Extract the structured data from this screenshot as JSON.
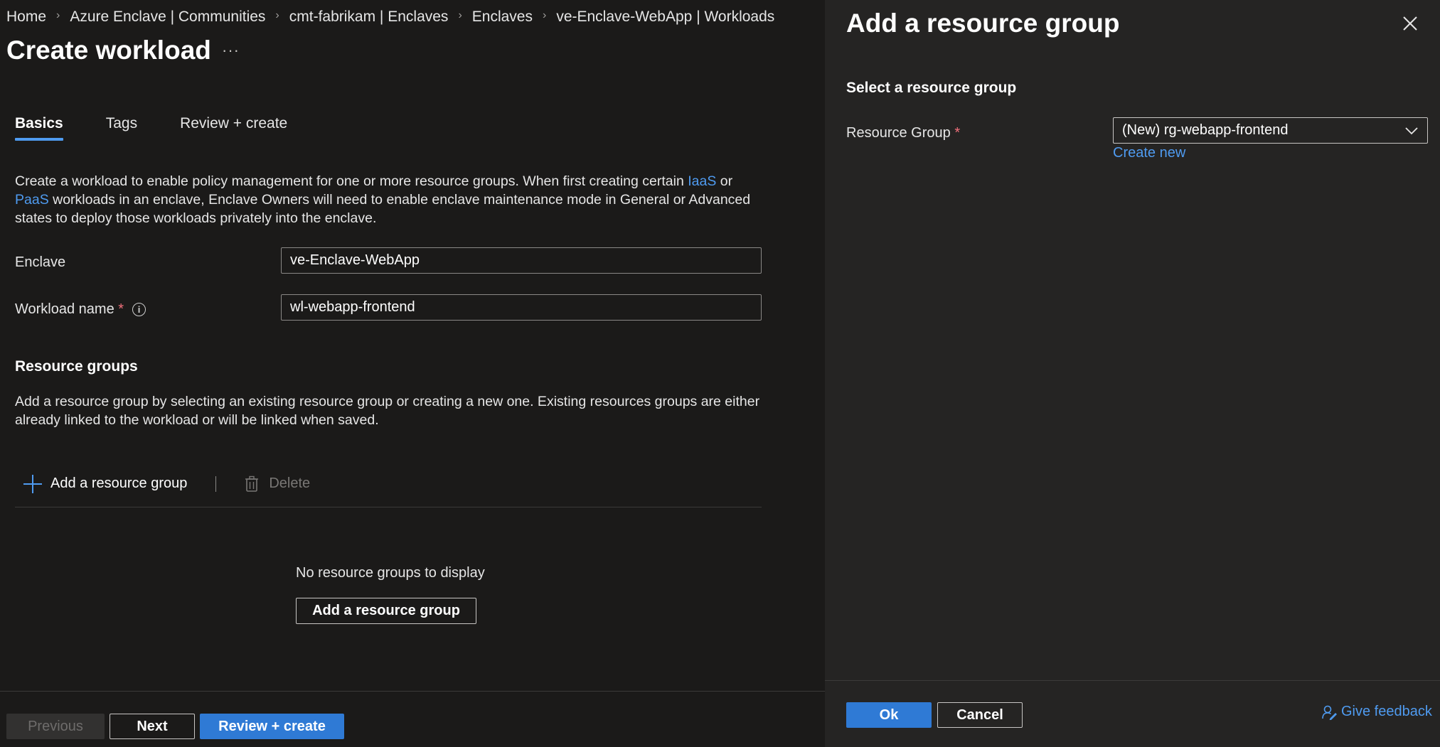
{
  "breadcrumb": [
    {
      "label": "Home"
    },
    {
      "label": "Azure Enclave | Communities"
    },
    {
      "label": "cmt-fabrikam | Enclaves"
    },
    {
      "label": "Enclaves"
    },
    {
      "label": "ve-Enclave-WebApp | Workloads"
    }
  ],
  "page": {
    "title": "Create workload",
    "more": "···"
  },
  "tabs": [
    {
      "label": "Basics",
      "active": true
    },
    {
      "label": "Tags",
      "active": false
    },
    {
      "label": "Review + create",
      "active": false
    }
  ],
  "description": {
    "part1": "Create a workload to enable policy management for one or more resource groups. When first creating certain ",
    "link1": "IaaS",
    "part2": " or ",
    "link2": "PaaS",
    "part3": " workloads in an enclave, Enclave Owners will need to enable enclave maintenance mode in General or Advanced states to deploy those workloads privately into the enclave."
  },
  "form": {
    "enclave_label": "Enclave",
    "enclave_value": "ve-Enclave-WebApp",
    "workload_label": "Workload name",
    "workload_value": "wl-webapp-frontend",
    "required_mark": "*",
    "info_glyph": "i"
  },
  "resource_groups": {
    "title": "Resource groups",
    "description": "Add a resource group by selecting an existing resource group or creating a new one. Existing resources groups are either already linked to the workload or will be linked when saved.",
    "add_label": "Add a resource group",
    "delete_label": "Delete",
    "empty_text": "No resource groups to display",
    "empty_button": "Add a resource group"
  },
  "footer": {
    "previous": "Previous",
    "next": "Next",
    "review": "Review + create"
  },
  "panel": {
    "title": "Add a resource group",
    "subtitle": "Select a resource group",
    "field_label": "Resource Group",
    "required_mark": "*",
    "selected_value": "(New) rg-webapp-frontend",
    "create_new": "Create new",
    "ok": "Ok",
    "cancel": "Cancel",
    "feedback": "Give feedback"
  },
  "colors": {
    "background": "#1b1a19",
    "panel_background": "#252423",
    "accent": "#2f7ad5",
    "link": "#4f9bf0",
    "required": "#f1707b"
  },
  "icons": [
    "chevron-right-icon",
    "more-icon",
    "info-icon",
    "plus-icon",
    "trash-icon",
    "close-icon",
    "chevron-down-icon",
    "feedback-icon"
  ]
}
